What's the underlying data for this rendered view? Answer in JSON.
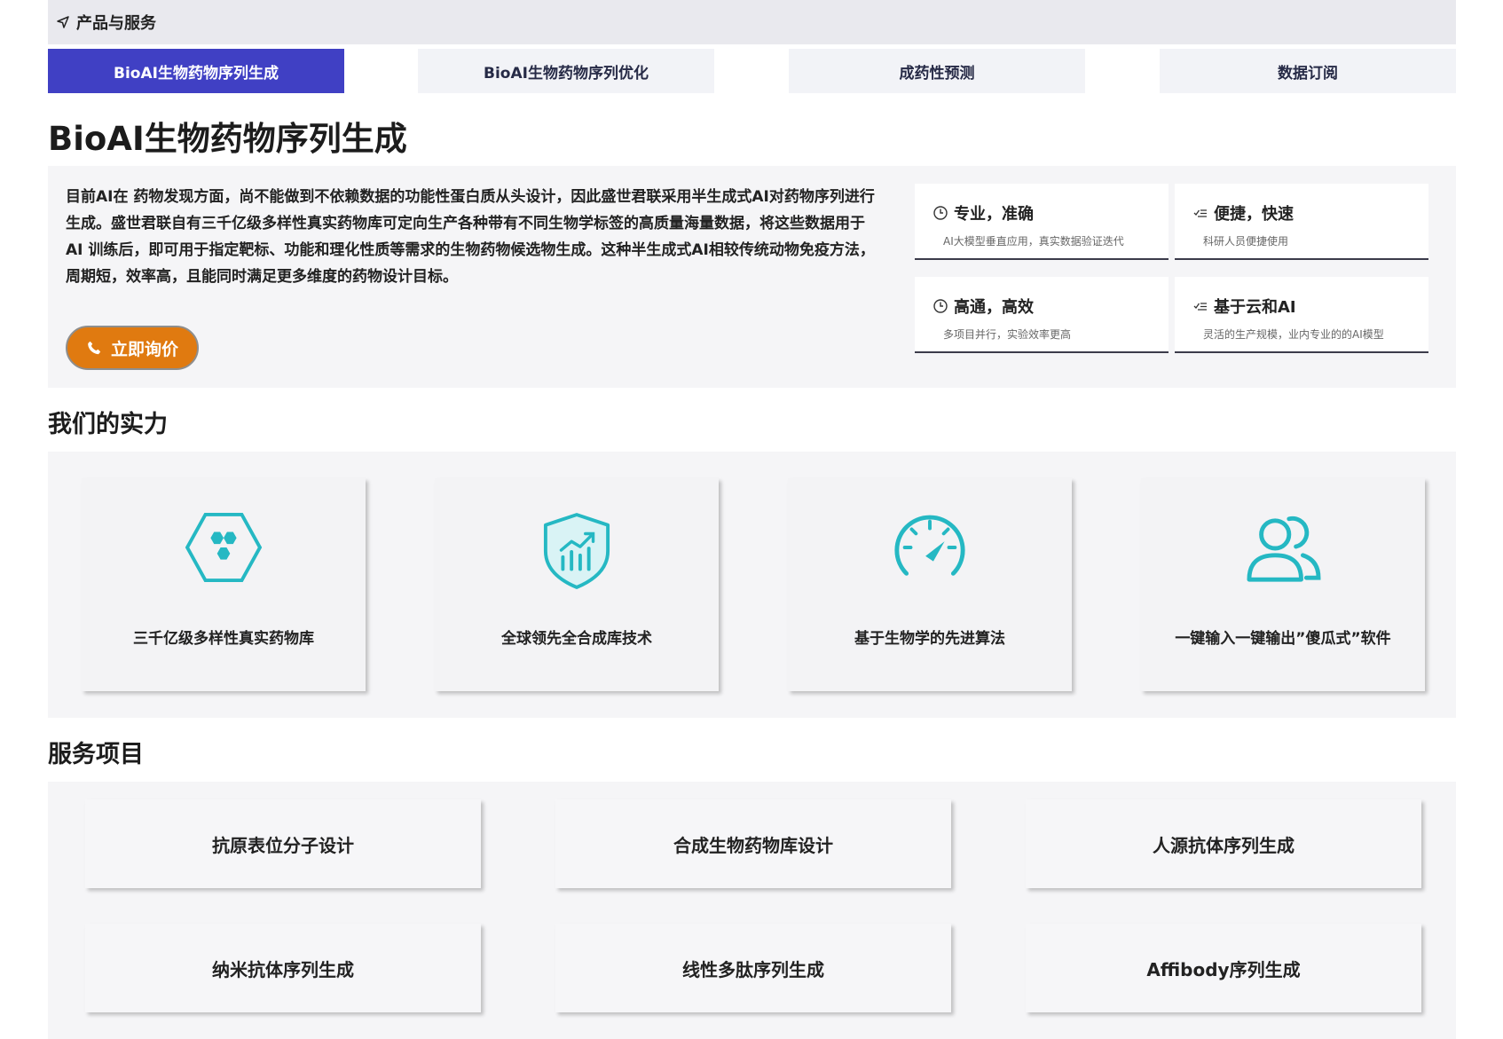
{
  "breadcrumb": {
    "label": "产品与服务"
  },
  "tabs": [
    {
      "label": "BioAI生物药物序列生成",
      "active": true
    },
    {
      "label": "BioAI生物药物序列优化",
      "active": false
    },
    {
      "label": "成药性预测",
      "active": false
    },
    {
      "label": "数据订阅",
      "active": false
    }
  ],
  "page_title": "BioAI生物药物序列生成",
  "intro": {
    "text": "目前AI在 药物发现方面，尚不能做到不依赖数据的功能性蛋白质从头设计，因此盛世君联采用半生成式AI对药物序列进行生成。盛世君联自有三千亿级多样性真实药物库可定向生产各种带有不同生物学标签的高质量海量数据，将这些数据用于AI 训练后，即可用于指定靶标、功能和理化性质等需求的生物药物候选物生成。这种半生成式AI相较传统动物免疫方法，周期短，效率高，且能同时满足更多维度的药物设计目标。",
    "cta_label": "立即询价"
  },
  "features": [
    {
      "icon": "clock-icon",
      "title": "专业，准确",
      "subtitle": "AI大模型垂直应用，真实数据验证迭代"
    },
    {
      "icon": "checklist-icon",
      "title": "便捷，快速",
      "subtitle": "科研人员便捷使用"
    },
    {
      "icon": "clock-icon",
      "title": "高通，高效",
      "subtitle": "多项目并行，实验效率更高"
    },
    {
      "icon": "checklist-icon",
      "title": "基于云和AI",
      "subtitle": "灵活的生产规模，业内专业的的AI模型"
    }
  ],
  "strength": {
    "title": "我们的实力",
    "items": [
      {
        "icon": "hexagon-cluster-icon",
        "label": "三千亿级多样性真实药物库"
      },
      {
        "icon": "shield-chart-icon",
        "label": "全球领先全合成库技术"
      },
      {
        "icon": "speedometer-icon",
        "label": "基于生物学的先进算法"
      },
      {
        "icon": "users-icon",
        "label": "一键输入一键输出”傻瓜式”软件"
      }
    ]
  },
  "services": {
    "title": "服务项目",
    "items": [
      "抗原表位分子设计",
      "合成生物药物库设计",
      "人源抗体序列生成",
      "纳米抗体序列生成",
      "线性多肽序列生成",
      "Affibody序列生成"
    ]
  },
  "colors": {
    "accent": "#4040c4",
    "cta": "#e07a10",
    "icon_teal": "#25b8c3"
  }
}
